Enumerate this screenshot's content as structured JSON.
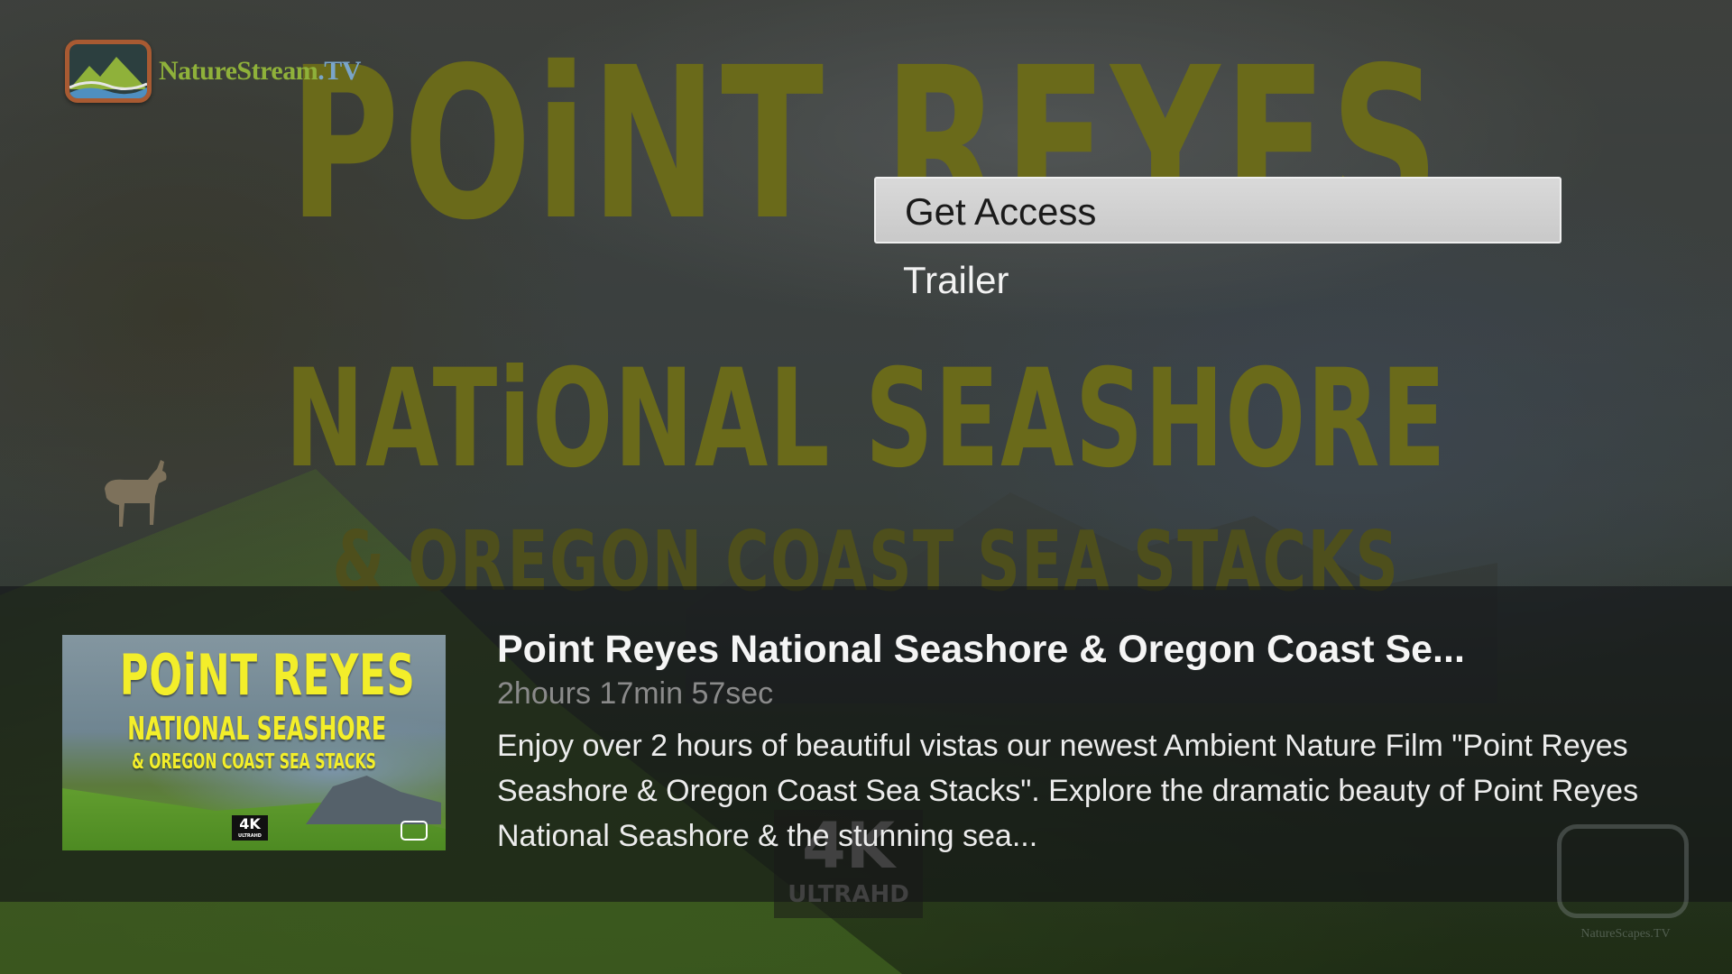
{
  "app": {
    "logo_text": "NatureStream",
    "logo_suffix": ".TV"
  },
  "poster": {
    "line1": "POiNT REYES",
    "line2": "NATiONAL SEASHORE",
    "line3": "& OREGON COAST SEA STACKS",
    "badge_4k": "4K",
    "badge_ultrahd": "ULTRAHD",
    "watermark": "NatureScapes.TV"
  },
  "menu": {
    "items": [
      {
        "label": "Get Access",
        "selected": true
      },
      {
        "label": "Trailer",
        "selected": false
      }
    ]
  },
  "details": {
    "thumbnail": {
      "line1": "POiNT REYES",
      "line2": "NATIONAL SEASHORE",
      "line3": "& OREGON COAST SEA STACKS",
      "badge": "4K",
      "badge_sub": "ULTRAHD"
    },
    "title": "Point Reyes National Seashore & Oregon Coast Se...",
    "duration": "2hours 17min 57sec",
    "description": "Enjoy over 2 hours of beautiful vistas our newest Ambient Nature Film \"Point Reyes Seashore & Oregon Coast Sea Stacks\". Explore the dramatic beauty of Point Reyes National Seashore &  the stunning sea..."
  },
  "colors": {
    "poster_text": "#6a6a1a",
    "selected_bg": "#d0d0d0",
    "menu_text": "#f2f2f2",
    "duration_text": "#8a8a8a",
    "thumb_title": "#f3ee2a",
    "logo_green": "#8fb13a",
    "logo_border": "#a85a32"
  }
}
